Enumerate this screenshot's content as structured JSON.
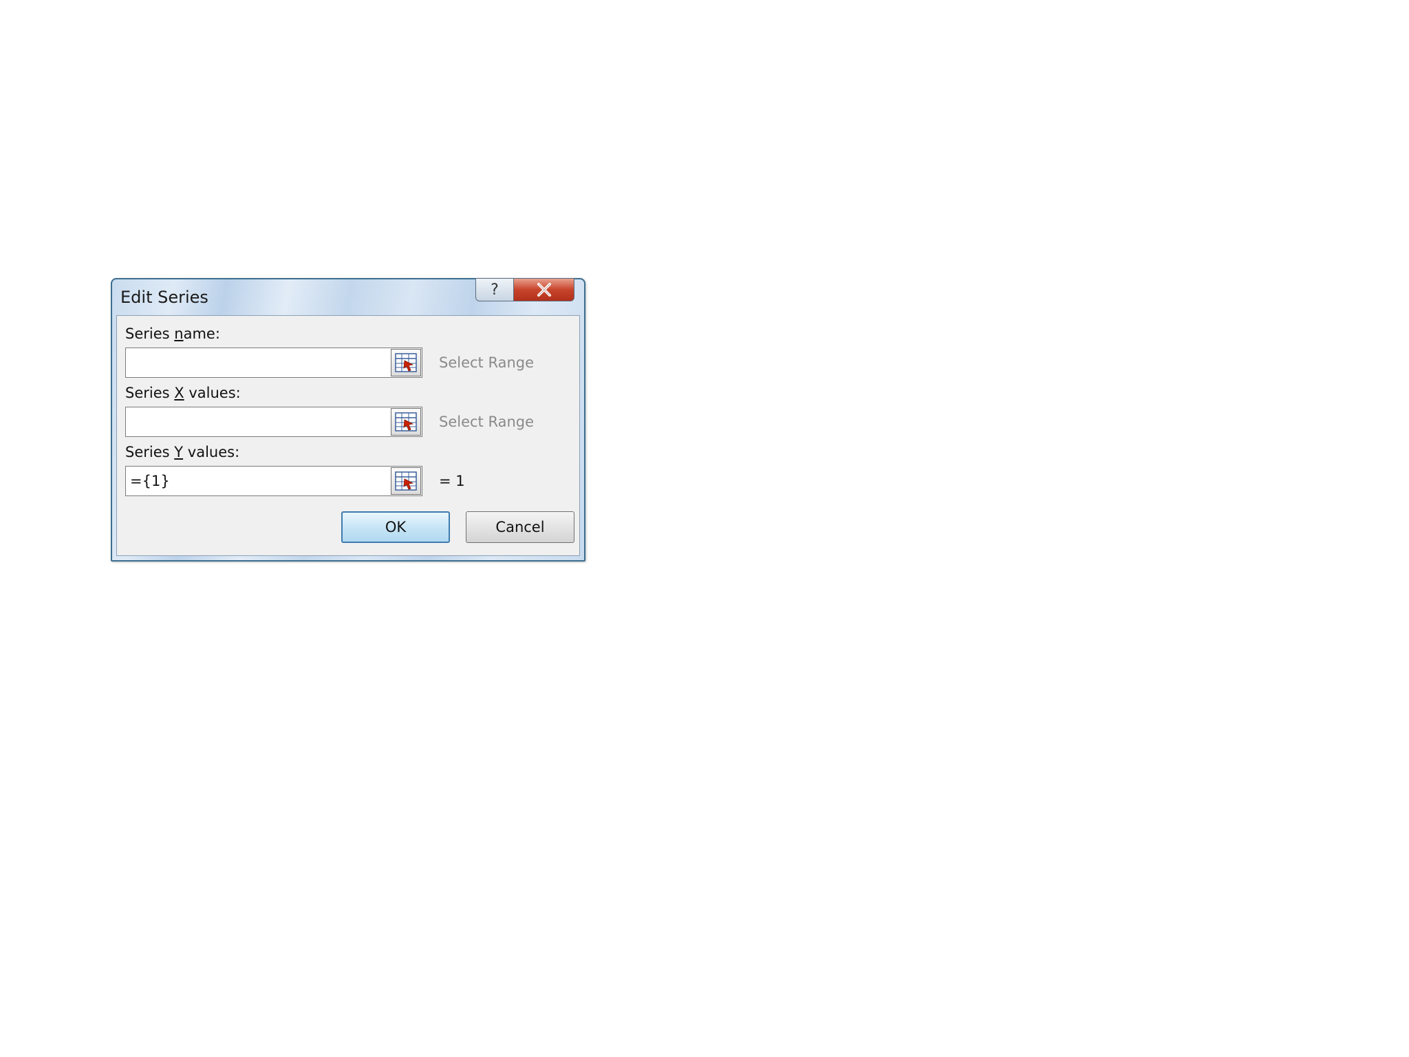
{
  "dialog": {
    "title": "Edit Series",
    "help_glyph": "?",
    "close_icon": "close-icon"
  },
  "fields": [
    {
      "label_before": "Series ",
      "label_mnemonic": "n",
      "label_after": "ame:",
      "value": "",
      "side_text": "Select Range",
      "side_style": "dim"
    },
    {
      "label_before": "Series ",
      "label_mnemonic": "X",
      "label_after": " values:",
      "value": "",
      "side_text": "Select Range",
      "side_style": "dim"
    },
    {
      "label_before": "Series ",
      "label_mnemonic": "Y",
      "label_after": " values:",
      "value": "={1}",
      "side_text": "= 1",
      "side_style": "dark"
    }
  ],
  "buttons": {
    "ok_label": "OK",
    "cancel_label": "Cancel"
  },
  "colors": {
    "close_red": "#c8442c",
    "ok_border": "#3d7bad",
    "range_icon_red": "#cc2200",
    "range_icon_blue": "#3a5f9a"
  }
}
